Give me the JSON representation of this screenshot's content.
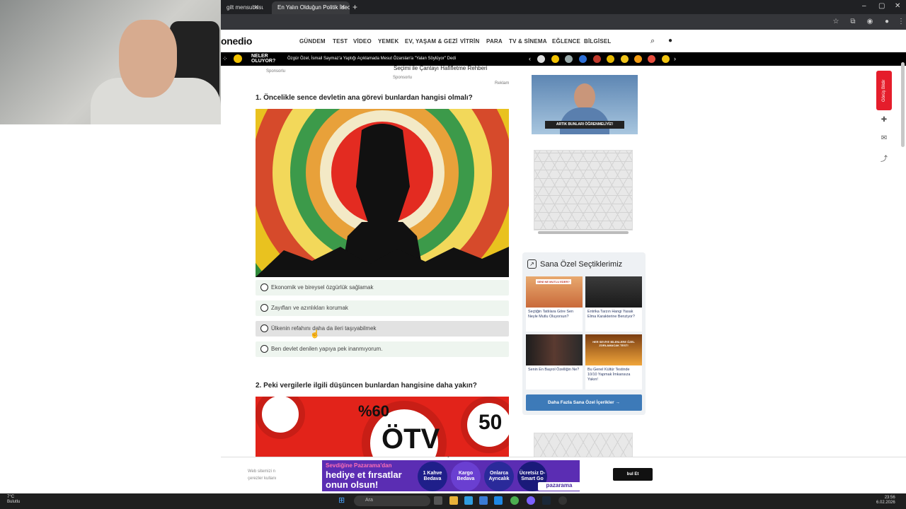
{
  "browser": {
    "tabs": [
      {
        "title": "gilt mensubusun"
      },
      {
        "title": "En Yalın Olduğun Politik İdeoloji"
      }
    ],
    "new_tab": "+",
    "window_controls": [
      "–",
      "▢",
      "✕"
    ]
  },
  "site": {
    "logo": "onedio",
    "nav": [
      "GÜNDEM",
      "TEST",
      "VİDEO",
      "YEMEK",
      "EV, YAŞAM & GEZİ",
      "VİTRİN",
      "PARA",
      "TV & SİNEMA",
      "EĞLENCE",
      "BİLGİSEL"
    ],
    "ticker_logo_line1": "NELER",
    "ticker_logo_line2": "OLUYOR?",
    "ticker_text": "Özgür Özel, İsmail Saymaz'a Yaptığı Açıklamada Mesut Özarslan'a \"Yalan Söylüyor\" Dedi"
  },
  "sponsored": {
    "label_left": "Sponsorlu",
    "title": "Seçimi ile Çantayı Hafifletme Rehberi",
    "label_right": "Sponsorlu",
    "ad_label": "Reklam"
  },
  "question1": {
    "title": "1. Öncelikle sence devletin ana görevi bunlardan hangisi olmalı?",
    "options": [
      "Ekonomik ve bireysel özgürlük sağlamak",
      "Zayıfları ve azınlıkları korumak",
      "Ülkenin refahını daha da ileri taşıyabilmek",
      "Ben devlet denilen yapıya pek inanmıyorum."
    ]
  },
  "question2": {
    "title": "2. Peki vergilerle ilgili düşüncen bunlardan hangisine daha yakın?",
    "image_text_1": "%60",
    "image_text_2": "ÖTV",
    "image_text_3": "50"
  },
  "sidebar": {
    "promo_caption": "ARTIK BUNLARI ÖĞRENMELİYİZ!",
    "picks_title": "Sana Özel Seçtiklerimiz",
    "cards": [
      {
        "caption": "Seçtiğin Tatlılara Göre Sen Neyle Mutlu Oluyorsun?",
        "thumb_text": "SENİ NE MUTLU EDER?"
      },
      {
        "caption": "Entrika Tarzın Hangi Yasak Elma Karakterine Benziyor?",
        "thumb_text": ""
      },
      {
        "caption": "Senin En Başrol Özelliğin Ne?",
        "thumb_text": ""
      },
      {
        "caption": "Bu Genel Kültür Testinde 10/10 Yapmak İmkansıza Yakın!",
        "thumb_text": "HER SEVİYE BİLENLERE ÖZEL ZORLAMACAK TEST!"
      }
    ],
    "more_button": "Daha Fazla Sana Özel İçerikler →"
  },
  "rail": {
    "feedback": "Görüş Bildir"
  },
  "cookie": {
    "line1": "Web sitemizi n",
    "line2": "çerezler kullanı",
    "accept": "bul Et"
  },
  "banner": {
    "line1": "Sevdiğine Pazarama'dan",
    "line2": "hediye et fırsatlar",
    "line3": "onun olsun!",
    "circles": [
      "1 Kahve Bedava",
      "Kargo Bedava",
      "Onlarca Ayrıcalık",
      "Ücretsiz D-Smart Go"
    ],
    "brand": "pazarama"
  },
  "taskbar": {
    "temp": "7°C",
    "weather": "Bulutlu",
    "search": "Ara",
    "time": "23:56",
    "date": "6.02.2026"
  },
  "colors": {
    "accent_blue": "#3d7ab8",
    "feedback_red": "#e51d2b",
    "option_bg": "#eef5ef"
  }
}
